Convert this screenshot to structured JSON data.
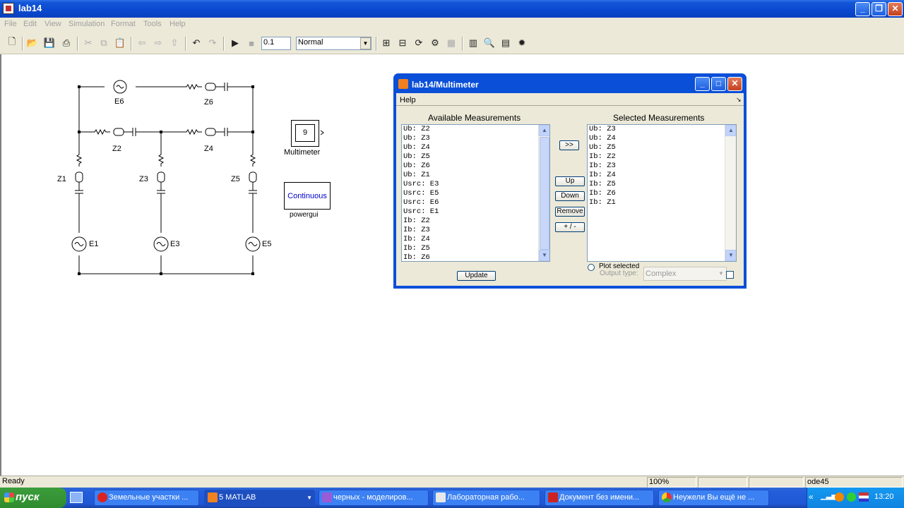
{
  "window": {
    "title": "lab14"
  },
  "menu": [
    "File",
    "Edit",
    "View",
    "Simulation",
    "Format",
    "Tools",
    "Help"
  ],
  "toolbar": {
    "stop_time": "0.1",
    "sim_mode": "Normal"
  },
  "model": {
    "labels": {
      "e6": "E6",
      "z6": "Z6",
      "z2": "Z2",
      "z4": "Z4",
      "z1": "Z1",
      "z3": "Z3",
      "z5": "Z5",
      "e1": "E1",
      "e3": "E3",
      "e5": "E5"
    },
    "multimeter": {
      "count": "9",
      "label": "Multimeter"
    },
    "powergui": {
      "mode": "Continuous",
      "label": "powergui"
    }
  },
  "dialog": {
    "title": "lab14/Multimeter",
    "menu_help": "Help",
    "available_header": "Available Measurements",
    "selected_header": "Selected Measurements",
    "available": [
      "Ub: Z2",
      "Ub: Z3",
      "Ub: Z4",
      "Ub: Z5",
      "Ub: Z6",
      "Ub: Z1",
      "Usrc: E3",
      "Usrc: E5",
      "Usrc: E6",
      "Usrc: E1",
      "Ib: Z2",
      "Ib: Z3",
      "Ib: Z4",
      "Ib: Z5",
      "Ib: Z6"
    ],
    "selected": [
      "Ub: Z3",
      "Ub: Z4",
      "Ub: Z5",
      "Ib: Z2",
      "Ib: Z3",
      "Ib: Z4",
      "Ib: Z5",
      "Ib: Z6",
      "Ib: Z1"
    ],
    "buttons": {
      "add": ">>",
      "up": "Up",
      "down": "Down",
      "remove": "Remove",
      "sign": "+ / -",
      "update": "Update"
    },
    "plot_selected": "Plot selected",
    "output_type_label": "Output type:",
    "output_type_value": "Complex"
  },
  "status": {
    "text": "Ready",
    "zoom": "100%",
    "solver": "ode45"
  },
  "taskbar": {
    "start": "пуск",
    "tasks": [
      "Земельные участки ...",
      "5 MATLAB",
      "черных - моделиров...",
      "Лабораторная рабо...",
      "Документ без имени...",
      "Неужели Вы ещё не ..."
    ],
    "clock": "13:20"
  },
  "colors": {
    "title_blue": "#0a4fd8",
    "start_green": "#3c9d3c",
    "taskbar_blue": "#245edb"
  }
}
